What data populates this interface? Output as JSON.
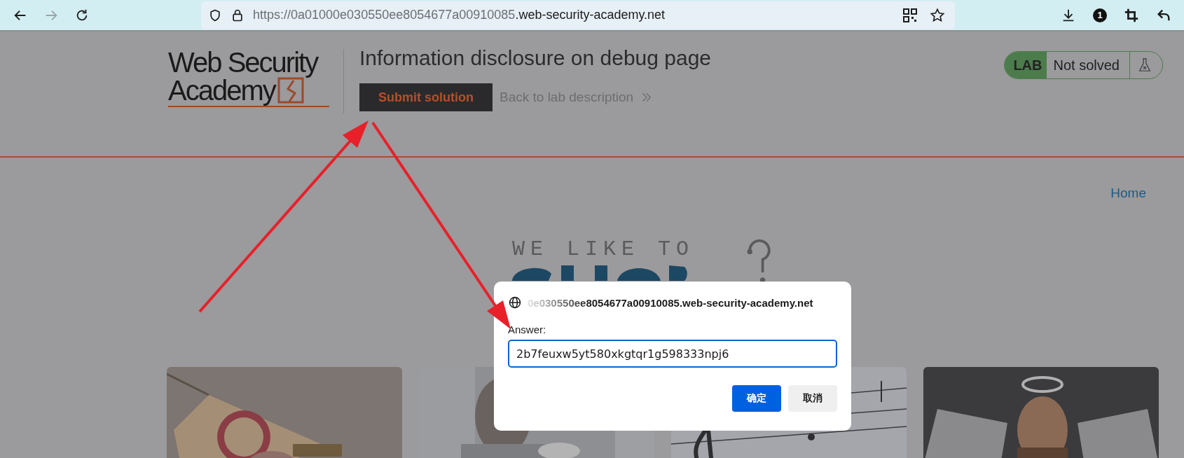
{
  "browser": {
    "back_enabled": true,
    "forward_enabled": false,
    "url_prefix": "https://0a01000e030550ee8054677a00910085",
    "url_domain": ".web-security-academy.net",
    "downloads_badge": "1"
  },
  "header": {
    "logo_lines": [
      "Web Security",
      "Academy"
    ],
    "title": "Information disclosure on debug page",
    "submit_button": "Submit solution",
    "back_link": "Back to lab description",
    "lab_label": "LAB",
    "lab_status": "Not solved",
    "solved": false
  },
  "nav": {
    "home": "Home"
  },
  "banner": {
    "line_1": "WE LIKE TO"
  },
  "dialog": {
    "origin": "0e030550ee8054677a00910085.web-security-academy.net",
    "label": "Answer:",
    "value": "2b7feuxw5yt580xkgtqr1g598333npj6",
    "buttons": [
      {
        "label": "确定",
        "primary": true
      },
      {
        "label": "取消",
        "primary": false
      }
    ]
  }
}
